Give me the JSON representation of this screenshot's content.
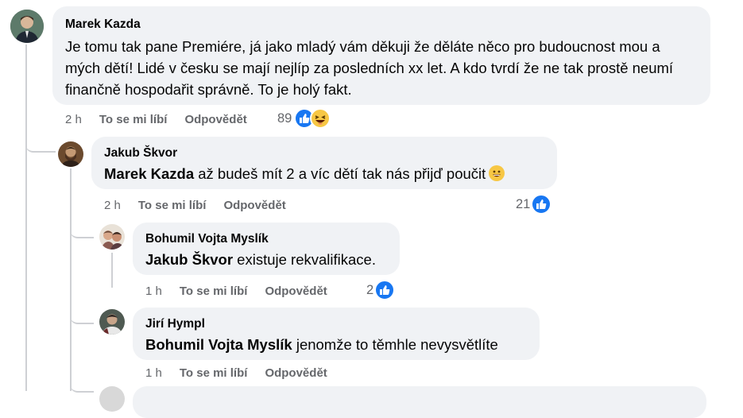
{
  "comments": [
    {
      "author": "Marek Kazda",
      "text": "Je tomu tak pane Premiére, já jako mladý vám děkuji že děláte něco pro budoucnost mou a mých dětí! Lidé v česku se mají nejlíp za posledních xx let. A kdo tvrdí že ne tak prostě neumí finančně hospodařit správně. To je holý fakt.",
      "time": "2 h",
      "like_label": "To se mi líbí",
      "reply_label": "Odpovědět",
      "reaction_count": "89",
      "reactions": [
        "like-icon",
        "haha-icon"
      ]
    },
    {
      "author": "Jakub Škvor",
      "mention": "Marek Kazda",
      "text": " až budeš mít 2 a víc dětí tak nás přijď poučit",
      "emoji": "grinning-face-icon",
      "time": "2 h",
      "like_label": "To se mi líbí",
      "reply_label": "Odpovědět",
      "reaction_count": "21",
      "reactions": [
        "like-icon"
      ]
    },
    {
      "author": "Bohumil Vojta Myslík",
      "mention": "Jakub Škvor",
      "text": " existuje rekvalifikace.",
      "time": "1 h",
      "like_label": "To se mi líbí",
      "reply_label": "Odpovědět",
      "reaction_count": "2",
      "reactions": [
        "like-icon"
      ]
    },
    {
      "author": "Jirí Hympl",
      "mention": "Bohumil Vojta Myslík",
      "text": " jenomže to těmhle nevysvětlíte",
      "time": "1 h",
      "like_label": "To se mi líbí",
      "reply_label": "Odpovědět"
    }
  ],
  "colors": {
    "bubble": "#f0f2f5",
    "secondary_text": "#65676b",
    "like_blue": "#1877f2",
    "thread_line": "#ced0d4"
  }
}
